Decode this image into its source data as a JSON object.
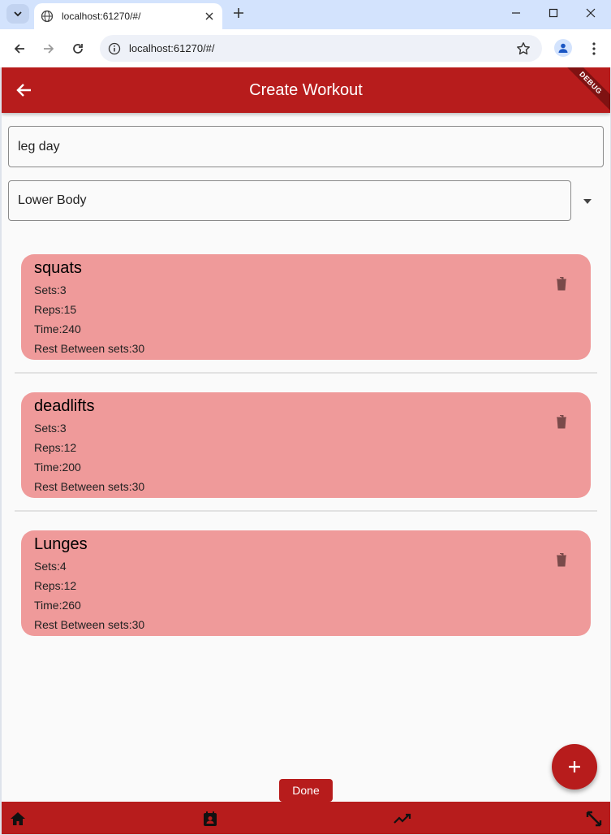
{
  "browser": {
    "tab_title": "localhost:61270/#/",
    "url": "localhost:61270/#/"
  },
  "appbar": {
    "title": "Create Workout",
    "debug_banner": "DEBUG"
  },
  "form": {
    "workout_name": "leg day",
    "category": "Lower Body"
  },
  "exercises": [
    {
      "name": "squats",
      "sets": "Sets:3",
      "reps": "Reps:15",
      "time": "Time:240",
      "rest": "Rest Between sets:30"
    },
    {
      "name": "deadlifts",
      "sets": "Sets:3",
      "reps": "Reps:12",
      "time": "Time:200",
      "rest": "Rest Between sets:30"
    },
    {
      "name": "Lunges",
      "sets": "Sets:4",
      "reps": "Reps:12",
      "time": "Time:260",
      "rest": "Rest Between sets:30"
    }
  ],
  "actions": {
    "done_label": "Done",
    "fab_icon": "plus-icon"
  },
  "bottom_nav": {
    "items": [
      "home-icon",
      "contact-card-icon",
      "trending-up-icon",
      "fullscreen-icon"
    ]
  },
  "colors": {
    "primary": "#b71c1c",
    "card": "#ef9a9a",
    "background": "#fafafa"
  }
}
